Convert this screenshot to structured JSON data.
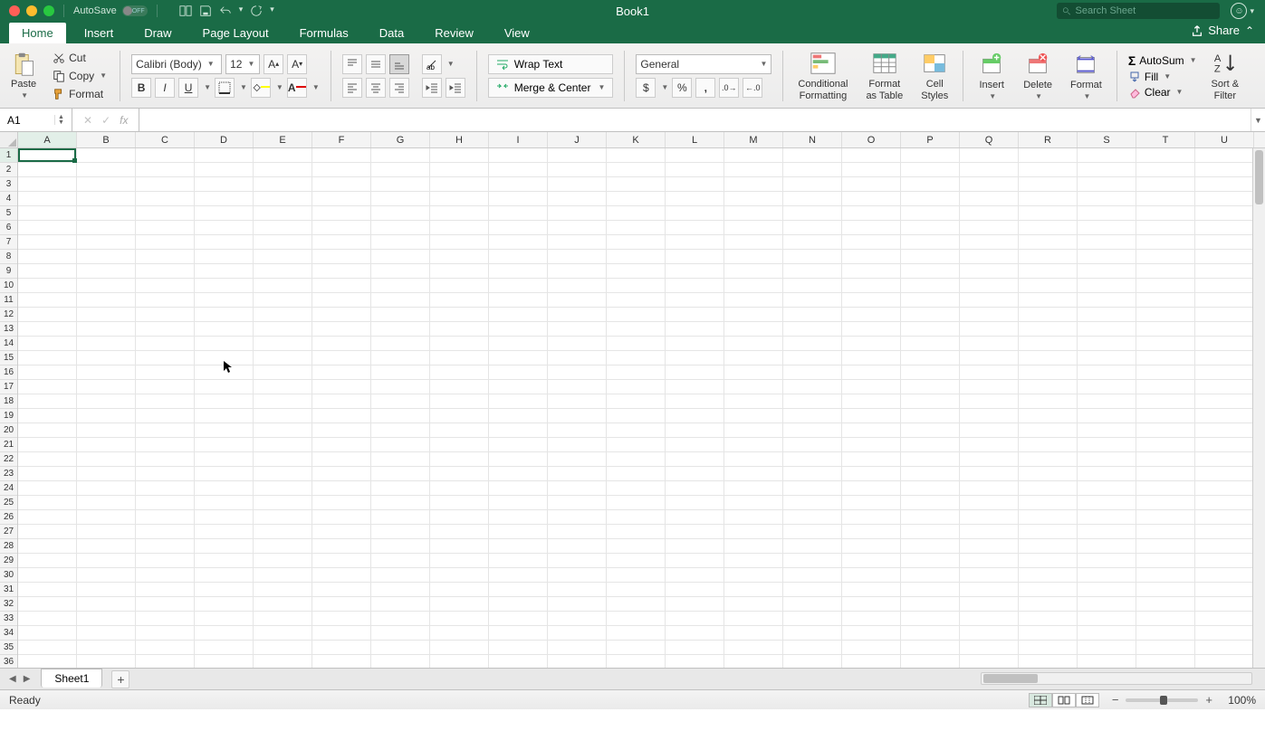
{
  "window": {
    "title": "Book1",
    "autosave_label": "AutoSave",
    "autosave_state": "OFF",
    "search_placeholder": "Search Sheet"
  },
  "menu_tabs": [
    "Home",
    "Insert",
    "Draw",
    "Page Layout",
    "Formulas",
    "Data",
    "Review",
    "View"
  ],
  "active_menu_tab": "Home",
  "share_label": "Share",
  "ribbon": {
    "paste": "Paste",
    "cut": "Cut",
    "copy": "Copy",
    "format_painter": "Format",
    "font_name": "Calibri (Body)",
    "font_size": "12",
    "wrap_text": "Wrap Text",
    "merge_center": "Merge & Center",
    "number_format": "General",
    "cond_fmt_l1": "Conditional",
    "cond_fmt_l2": "Formatting",
    "fmt_table_l1": "Format",
    "fmt_table_l2": "as Table",
    "cell_styles_l1": "Cell",
    "cell_styles_l2": "Styles",
    "insert": "Insert",
    "delete": "Delete",
    "format": "Format",
    "autosum": "AutoSum",
    "fill": "Fill",
    "clear": "Clear",
    "sortfilter_l1": "Sort &",
    "sortfilter_l2": "Filter"
  },
  "namebox": "A1",
  "formula": "",
  "columns": [
    "A",
    "B",
    "C",
    "D",
    "E",
    "F",
    "G",
    "H",
    "I",
    "J",
    "K",
    "L",
    "M",
    "N",
    "O",
    "P",
    "Q",
    "R",
    "S",
    "T",
    "U"
  ],
  "row_count": 37,
  "active_cell": {
    "col": "A",
    "row": 1
  },
  "sheet_tabs": [
    "Sheet1"
  ],
  "active_sheet": "Sheet1",
  "status": "Ready",
  "zoom": "100%"
}
